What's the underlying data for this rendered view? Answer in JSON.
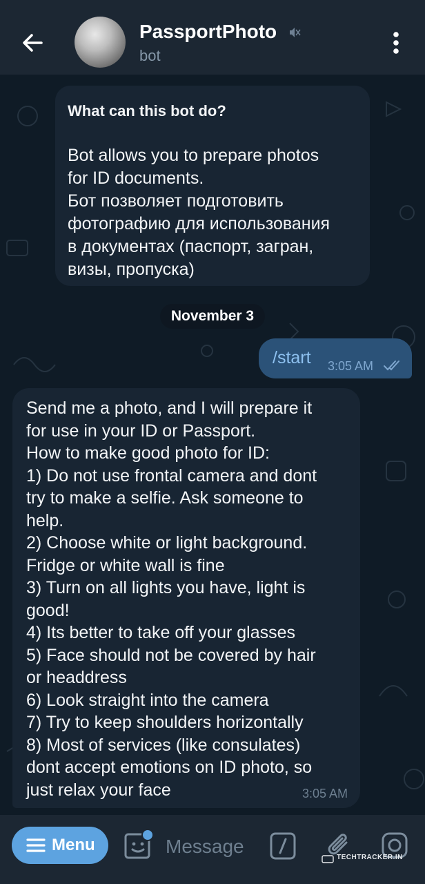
{
  "header": {
    "title": "PassportPhoto",
    "subtitle": "bot"
  },
  "chat": {
    "bot_info": {
      "title": "What can this bot do?",
      "body": "Bot allows you to prepare photos\nfor ID documents.\nБот позволяет подготовить\nфотографию для использования\nв документах (паспорт, загран,\nвизы, пропуска)"
    },
    "date_separator": "November 3",
    "outgoing": {
      "text": "/start",
      "time": "3:05 AM"
    },
    "incoming": {
      "text": "Send me a photo, and I will prepare it\nfor use in your ID or Passport.\nHow to make good photo for ID:\n1) Do not use frontal camera and dont\ntry to make a selfie. Ask someone to\nhelp.\n2) Choose white or light background.\nFridge or white wall is fine\n3) Turn on all lights you have, light is\ngood!\n4) Its better to take off your glasses\n5) Face should not be covered by hair\nor headdress\n6) Look straight into the camera\n7) Try to keep shoulders horizontally\n8) Most of services (like consulates)\ndont accept emotions on ID photo, so\njust relax your face",
      "time": "3:05 AM"
    }
  },
  "input_bar": {
    "menu_label": "Menu",
    "placeholder": "Message"
  },
  "watermark": "TECHTRACKER.IN",
  "colors": {
    "background": "#0e1621",
    "header": "#1c2733",
    "incoming_bubble": "#182533",
    "outgoing_bubble": "#2b5278",
    "accent": "#5da3e0"
  },
  "icons": [
    "back-arrow-icon",
    "mute-icon",
    "more-vertical-icon",
    "double-check-icon",
    "menu-lines-icon",
    "sticker-icon",
    "bot-command-icon",
    "attach-icon",
    "camera-icon"
  ]
}
